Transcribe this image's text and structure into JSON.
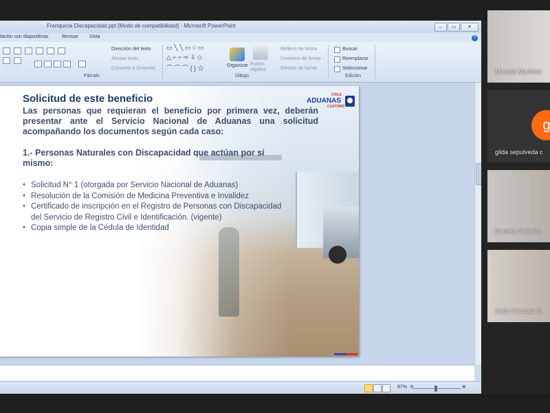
{
  "window": {
    "title": "Franquicia Discapacidad.ppt [Modo de compatibilidad] - Microsoft PowerPoint",
    "minimize": "–",
    "restore": "▭",
    "close": "✕",
    "help": "?"
  },
  "menu": {
    "items": [
      "tación con diapositivas",
      "Revisar",
      "Vista"
    ]
  },
  "ribbon": {
    "groups": {
      "parrafo": "Párrafo",
      "dibujo": "Dibujo",
      "edicion": "Edición"
    },
    "parrafo_items": [
      "Dirección del texto",
      "Alinear texto",
      "Convertir a SmartArt"
    ],
    "dibujo_items": [
      "Organizar",
      "Estilos rápidos",
      "Relleno de forma",
      "Contorno de forma",
      "Efectos de forma"
    ],
    "edicion_items": [
      "Buscar",
      "Reemplazar",
      "Seleccionar"
    ]
  },
  "slide": {
    "title": "Solicitud de este beneficio",
    "logo": {
      "word": "ADUANAS",
      "top": "CHILE",
      "bottom": "CUSTOMS"
    },
    "intro": "Las personas que requieran el beneficio por primera vez, deberán presentar ante el Servicio Nacional de Aduanas una solicitud acompañando los documentos según cada caso:",
    "subheading": "1.- Personas Naturales con Discapacidad que actúan por sí mismo:",
    "bullets": [
      "Solicitud N° 1 (otorgada por Servicio Nacional de Aduanas)",
      "Resolución de la Comisión de Medicina Preventiva e Invalidez",
      "Certificado de inscripción en el Registro de Personas con Discapacidad del Servicio de Registro Civil e Identificación. (vigente)",
      "Copia simple de la Cédula de Identidad"
    ]
  },
  "status": {
    "zoom": "87%",
    "minus": "⊖",
    "plus": "⊕"
  },
  "participants": [
    {
      "name": "Micaela Martínez",
      "initial": ""
    },
    {
      "name": "gilda sepulveda c",
      "initial": "g"
    },
    {
      "name": "Daniela Gallardo",
      "initial": ""
    },
    {
      "name": "Karla Vásquez G",
      "initial": ""
    }
  ]
}
